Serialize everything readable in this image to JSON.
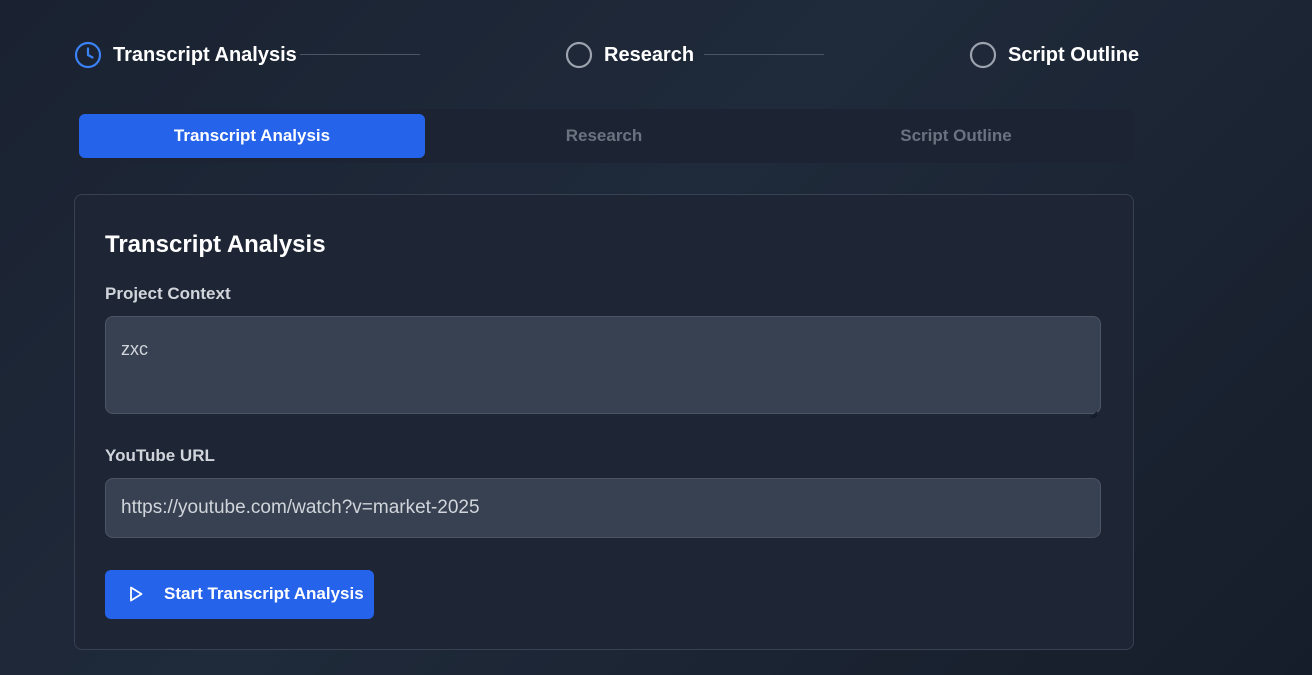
{
  "stepper": {
    "steps": [
      {
        "label": "Transcript Analysis",
        "state": "active",
        "icon": "clock-icon"
      },
      {
        "label": "Research",
        "state": "pending",
        "icon": "circle-icon"
      },
      {
        "label": "Script Outline",
        "state": "pending",
        "icon": "circle-icon"
      }
    ]
  },
  "tabs": [
    {
      "label": "Transcript Analysis",
      "active": true
    },
    {
      "label": "Research",
      "active": false
    },
    {
      "label": "Script Outline",
      "active": false
    }
  ],
  "card": {
    "title": "Transcript Analysis",
    "project_context": {
      "label": "Project Context",
      "value": "zxc"
    },
    "youtube_url": {
      "label": "YouTube URL",
      "value": "https://youtube.com/watch?v=market-2025"
    },
    "start_button": {
      "label": "Start Transcript Analysis",
      "icon": "play-icon"
    }
  },
  "colors": {
    "accent": "#2563eb",
    "background": "#1a2231",
    "card_background": "#1e2635",
    "input_background": "#374151",
    "inactive_text": "#6b7280"
  }
}
